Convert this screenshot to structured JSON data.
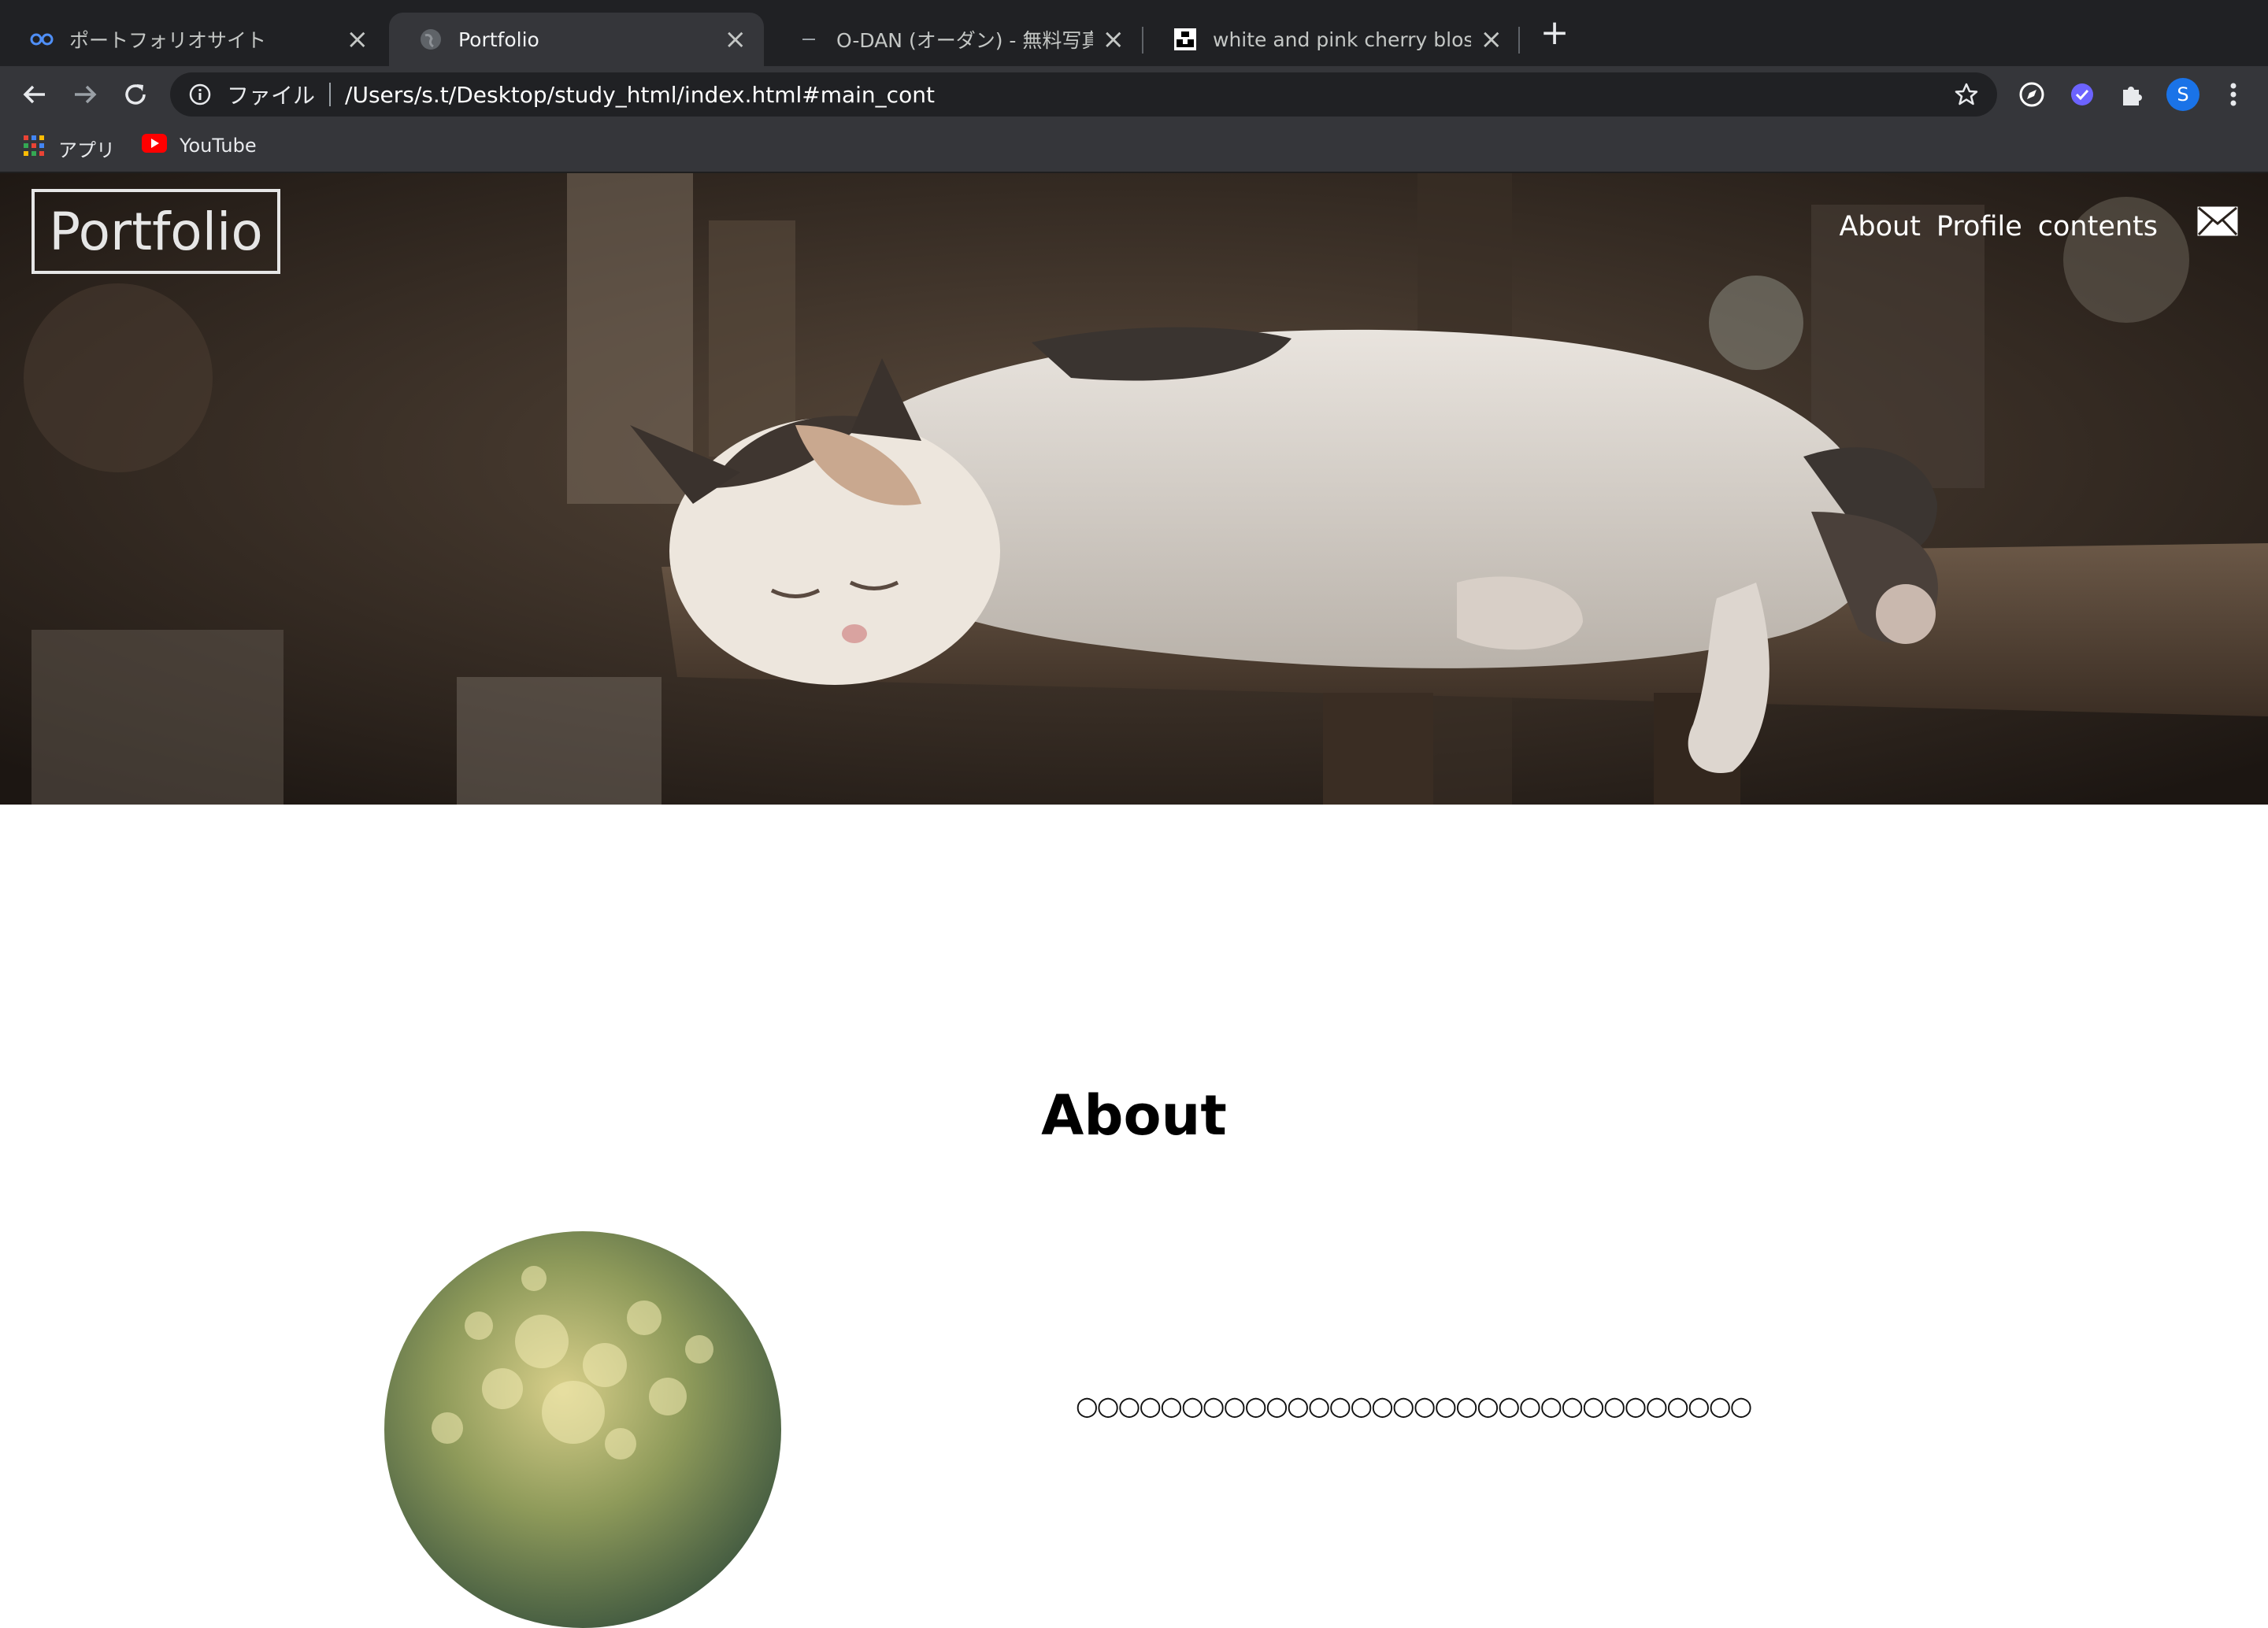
{
  "browser": {
    "tabs": [
      {
        "title": "ポートフォリオサイト",
        "icon": "infinity-icon",
        "active": false
      },
      {
        "title": "Portfolio",
        "icon": "globe-icon",
        "active": true
      },
      {
        "title": "O-DAN (オーダン) - 無料写真素",
        "icon": "dash-icon",
        "active": false
      },
      {
        "title": "white and pink cherry blossom",
        "icon": "unsplash-icon",
        "active": false
      }
    ],
    "new_tab": "+",
    "close_glyph": "×",
    "address": {
      "scheme_label": "ファイル",
      "url": "/Users/s.t/Desktop/study_html/index.html#main_cont"
    },
    "profile_initial": "S",
    "bookmarks": [
      {
        "label": "アプリ",
        "icon": "apps-grid-icon"
      },
      {
        "label": "YouTube",
        "icon": "youtube-icon"
      }
    ]
  },
  "page": {
    "logo": "Portfolio",
    "nav": [
      "About",
      "Profile",
      "contents"
    ],
    "about": {
      "title": "About",
      "text": "○○○○○○○○○○○○○○○○○○○○○○○○○○○○○○○○"
    }
  },
  "colors": {
    "tabstrip": "#202124",
    "toolbar": "#35363a",
    "omnibox": "#202124",
    "accent_blue": "#1a73e8",
    "youtube_red": "#ff0000"
  }
}
